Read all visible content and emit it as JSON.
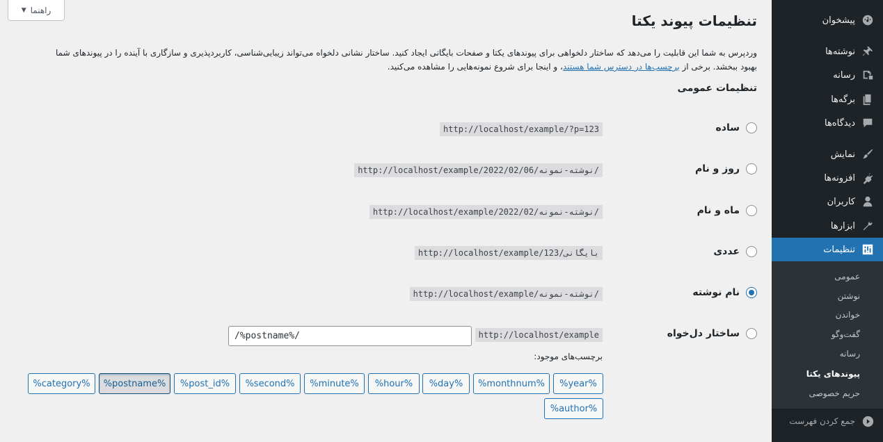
{
  "help_tab": {
    "label": "راهنما"
  },
  "page": {
    "title": "تنظیمات پیوند یکتا",
    "intro_before_link": "وردپرس به شما این قابلیت را می‌دهد که ساختار دلخواهی برای پیوندهای یکتا و صفحات بایگانی ایجاد کنید. ساختار نشانی دلخواه می‌تواند زیبایی‌شناسی، کاربردپذیری و سازگاری با آینده را در پیوندهای شما بهبود ببخشد. برخی از ",
    "intro_link": "برچسب‌ها در دسترس شما هستند",
    "intro_after_link": "، و اینجا برای شروع نمونه‌هایی را مشاهده می‌کنید.",
    "section_title": "تنظیمات عمومی"
  },
  "options": [
    {
      "label": "ساده",
      "example": "http://localhost/example/?p=123",
      "checked": false
    },
    {
      "label": "روز و نام",
      "example": "http://localhost/example/2022/02/06/نوشته-نمونه/",
      "checked": false
    },
    {
      "label": "ماه و نام",
      "example": "http://localhost/example/2022/02/نوشته-نمونه/",
      "checked": false
    },
    {
      "label": "عددی",
      "example": "http://localhost/example/بایگانی/123",
      "checked": false
    },
    {
      "label": "نام نوشته",
      "example": "http://localhost/example/نوشته-نمونه/",
      "checked": true
    },
    {
      "label": "ساختار دل‌خواه",
      "example": "http://localhost/example",
      "checked": false
    }
  ],
  "custom": {
    "value": "/%postname%/",
    "tags_label": "برچسب‌های موجود:",
    "tags": [
      "%year%",
      "%monthnum%",
      "%day%",
      "%hour%",
      "%minute%",
      "%second%",
      "%post_id%",
      "%postname%",
      "%category%",
      "%author%"
    ],
    "active_tag": "%postname%"
  },
  "sidebar": {
    "items": [
      {
        "label": "پیشخوان",
        "icon": "dashboard-icon"
      },
      {
        "label": "نوشته‌ها",
        "icon": "pin-icon"
      },
      {
        "label": "رسانه",
        "icon": "media-icon"
      },
      {
        "label": "برگه‌ها",
        "icon": "pages-icon"
      },
      {
        "label": "دیدگاه‌ها",
        "icon": "comments-icon"
      },
      {
        "label": "نمایش",
        "icon": "brush-icon"
      },
      {
        "label": "افزونه‌ها",
        "icon": "plugin-icon"
      },
      {
        "label": "کاربران",
        "icon": "user-icon"
      },
      {
        "label": "ابزارها",
        "icon": "wrench-icon"
      },
      {
        "label": "تنظیمات",
        "icon": "settings-icon"
      }
    ],
    "submenu": [
      "عمومی",
      "نوشتن",
      "خواندن",
      "گفت‌وگو",
      "رسانه",
      "پیوندهای یکتا",
      "حریم خصوصی"
    ],
    "current_submenu": "پیوندهای یکتا",
    "collapse_label": "جمع کردن فهرست"
  },
  "colors": {
    "accent": "#2271b1",
    "sidebar_bg": "#1d2327",
    "submenu_bg": "#2c3338"
  }
}
